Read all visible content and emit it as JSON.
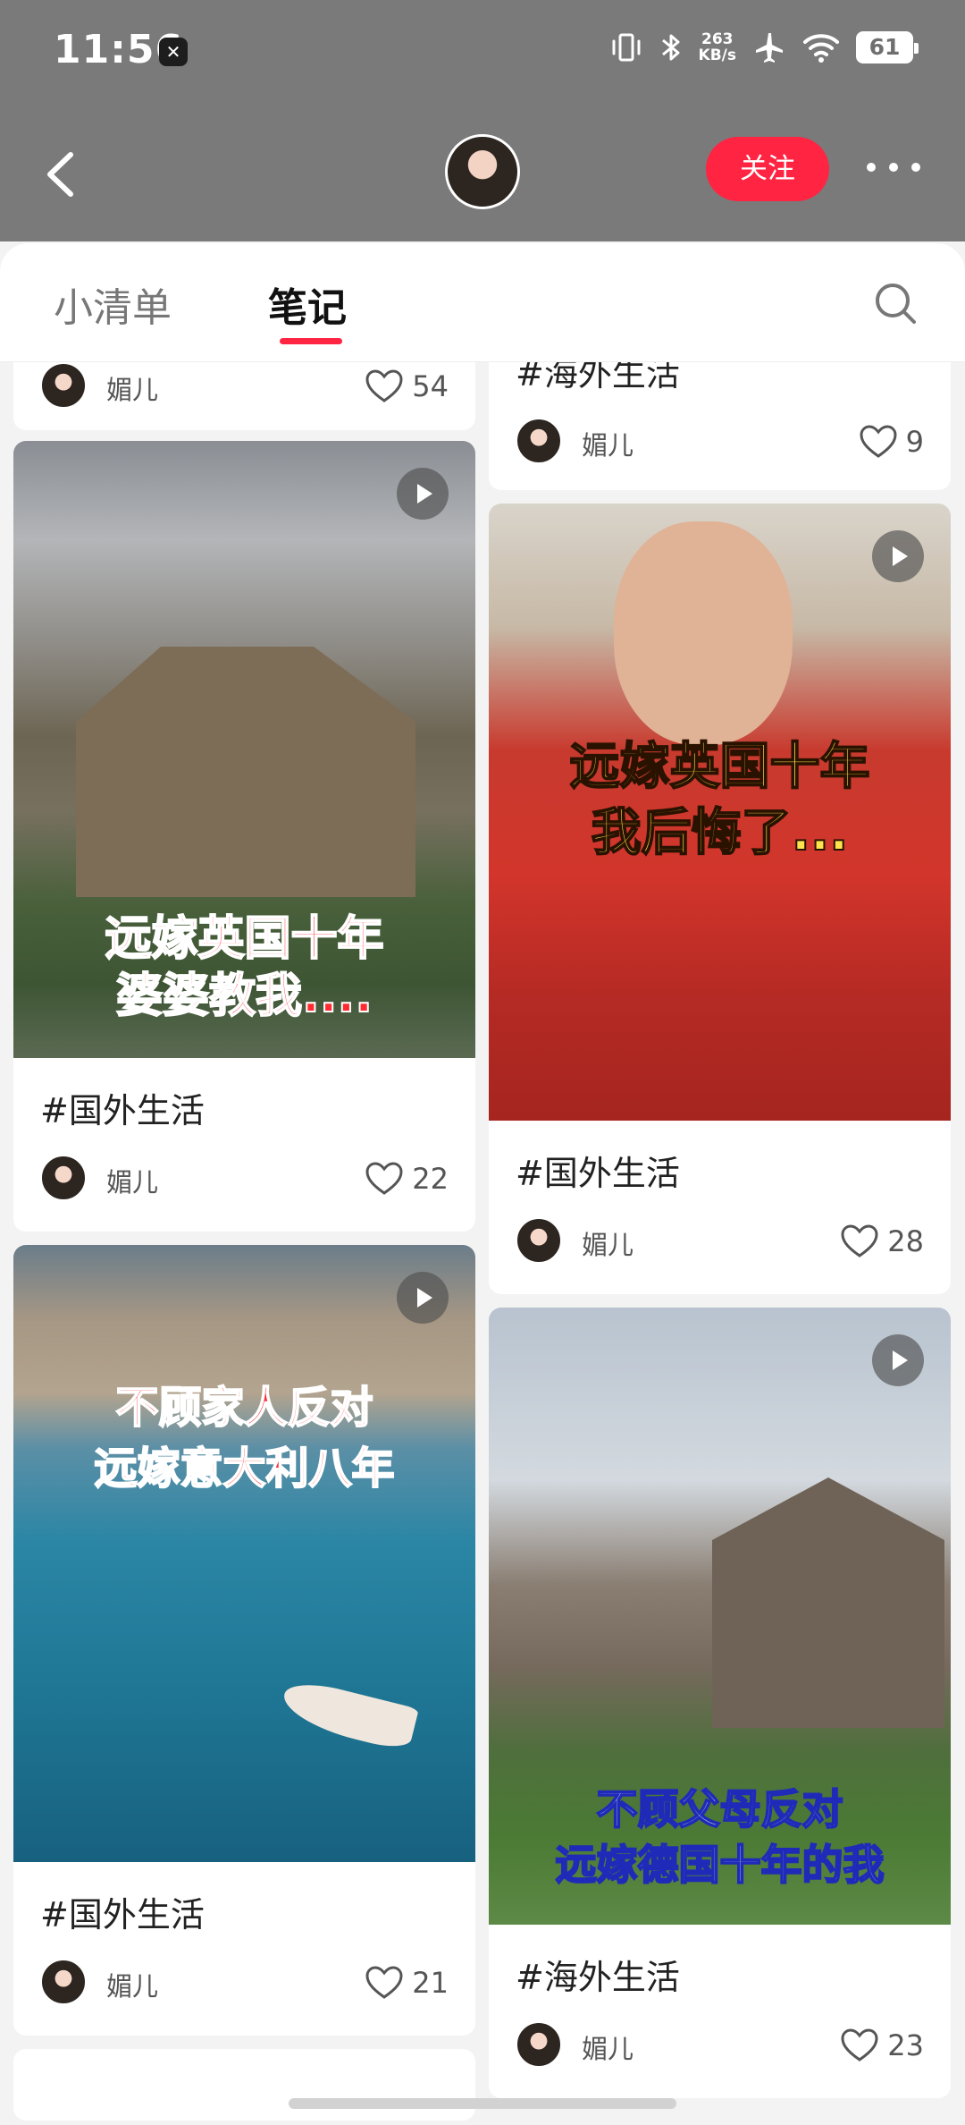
{
  "status_bar": {
    "time": "11:56",
    "network_speed": "263",
    "network_unit": "KB/s",
    "battery": "61"
  },
  "profile": {
    "follow_label": "关注"
  },
  "tabs": [
    {
      "label": "小清单"
    },
    {
      "label": "笔记"
    }
  ],
  "active_tab": "笔记",
  "feed": {
    "left_partial": {
      "author": "媚儿",
      "likes": "54"
    },
    "right_partial": {
      "title": "#海外生活",
      "author": "媚儿",
      "likes": "9"
    },
    "left": [
      {
        "overlay_line1": "远嫁英国十年",
        "overlay_line2": "婆婆教我....",
        "title": "#国外生活",
        "author": "媚儿",
        "likes": "22"
      },
      {
        "overlay_line1": "不顾家人反对",
        "overlay_line2": "远嫁意大利八年",
        "title": "#国外生活",
        "author": "媚儿",
        "likes": "21"
      }
    ],
    "right": [
      {
        "overlay_line1": "远嫁英国十年",
        "overlay_line2": "我后悔了...",
        "title": "#国外生活",
        "author": "媚儿",
        "likes": "28"
      },
      {
        "overlay_line1": "不顾父母反对",
        "overlay_line2": "远嫁德国十年的我",
        "title": "#海外生活",
        "author": "媚儿",
        "likes": "23"
      }
    ]
  },
  "colors": {
    "accent": "#ff2442",
    "status_bar": "#7a7a7a"
  }
}
